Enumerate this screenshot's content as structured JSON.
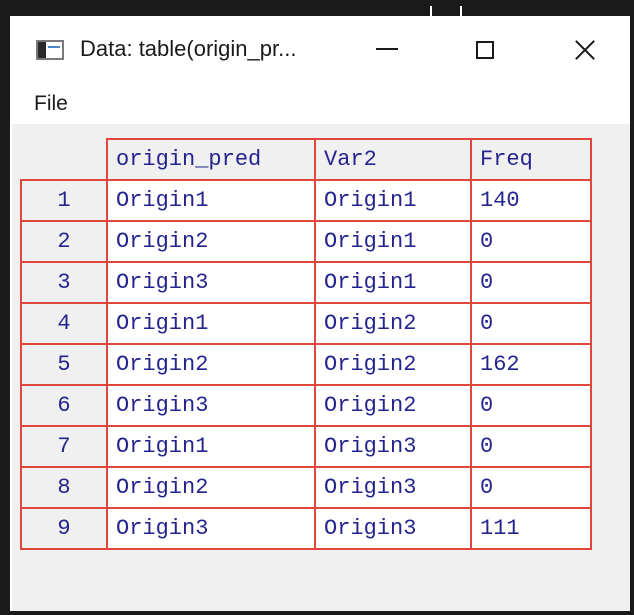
{
  "window": {
    "title": "Data: table(origin_pr...",
    "controls": [
      "minimize",
      "maximize",
      "close"
    ]
  },
  "menu": {
    "file": "File"
  },
  "table": {
    "columns": [
      "origin_pred",
      "Var2",
      "Freq"
    ],
    "rows": [
      {
        "num": "1",
        "origin_pred": "Origin1",
        "var2": "Origin1",
        "freq": "140"
      },
      {
        "num": "2",
        "origin_pred": "Origin2",
        "var2": "Origin1",
        "freq": "0"
      },
      {
        "num": "3",
        "origin_pred": "Origin3",
        "var2": "Origin1",
        "freq": "0"
      },
      {
        "num": "4",
        "origin_pred": "Origin1",
        "var2": "Origin2",
        "freq": "0"
      },
      {
        "num": "5",
        "origin_pred": "Origin2",
        "var2": "Origin2",
        "freq": "162"
      },
      {
        "num": "6",
        "origin_pred": "Origin3",
        "var2": "Origin2",
        "freq": "0"
      },
      {
        "num": "7",
        "origin_pred": "Origin1",
        "var2": "Origin3",
        "freq": "0"
      },
      {
        "num": "8",
        "origin_pred": "Origin2",
        "var2": "Origin3",
        "freq": "0"
      },
      {
        "num": "9",
        "origin_pred": "Origin3",
        "var2": "Origin3",
        "freq": "111"
      }
    ]
  },
  "colors": {
    "grid_border": "#e0463c",
    "cell_text": "#24248f",
    "header_bg": "#f0f0f0",
    "cell_bg": "#ffffff"
  }
}
